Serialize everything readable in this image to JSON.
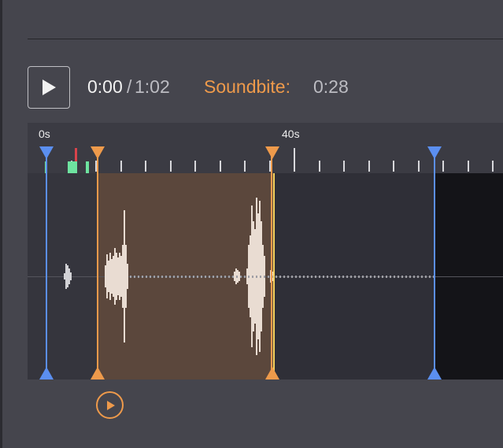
{
  "player": {
    "current_time": "0:00",
    "separator": "/",
    "total_time": "1:02"
  },
  "soundbite": {
    "label": "Soundbite:",
    "duration": "0:28"
  },
  "timeline": {
    "tick_labels": [
      "0s",
      "40s"
    ]
  },
  "colors": {
    "accent": "#ee9a4b",
    "handle_blue": "#5b8ff0",
    "handle_orange": "#ee9a4b",
    "selection": "#5b473c",
    "playhead": "#f7d25a",
    "marker_red": "#d9434b",
    "marker_green": "#6ee3a0"
  },
  "icons": {
    "play": "play-icon",
    "soundbite_play": "play-circle-icon"
  }
}
